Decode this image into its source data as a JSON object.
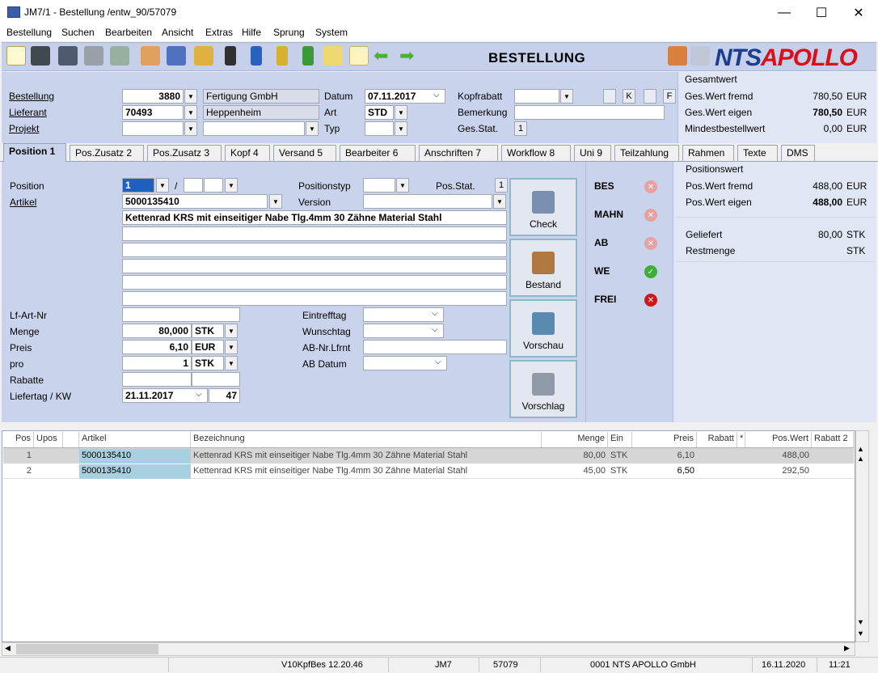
{
  "window": {
    "title": "JM7/1 - Bestellung /entw_90/57079",
    "minimize": "—",
    "maximize": "☐",
    "close": "✕"
  },
  "menu": [
    "Bestellung",
    "Suchen",
    "Bearbeiten",
    "Ansicht",
    "Extras",
    "Hilfe",
    "Sprung",
    "System"
  ],
  "toolbar": {
    "title": "BESTELLUNG",
    "logo_nts": "NTS",
    "logo_apollo": "APOLLO",
    "icons": [
      "new-document-icon",
      "binoculars-icon",
      "save-icon",
      "print-icon",
      "recycle-icon",
      "users-icon",
      "user-info-icon",
      "lock-folder-icon",
      "binder-black-icon",
      "binder-blue-icon",
      "binder-yellow-icon",
      "binder-green-icon",
      "notes-icon",
      "document-new-icon",
      "arrow-left-icon",
      "arrow-right-icon"
    ]
  },
  "header": {
    "bestellung_label": "Bestellung",
    "bestellung_value": "3880",
    "bestellung_name": "Fertigung GmbH",
    "lieferant_label": "Lieferant",
    "lieferant_value": "70493",
    "lieferant_name": "Heppenheim",
    "projekt_label": "Projekt",
    "projekt_value": "",
    "projekt_name": "",
    "datum_label": "Datum",
    "datum_value": "07.11.2017",
    "art_label": "Art",
    "art_value": "STD",
    "typ_label": "Typ",
    "typ_value": "",
    "kopfrabatt_label": "Kopfrabatt",
    "kopfrabatt_value": "",
    "bemerkung_label": "Bemerkung",
    "bemerkung_value": "",
    "gesstat_label": "Ges.Stat.",
    "gesstat_value": "1",
    "flag_k": "K",
    "flag_f": "F"
  },
  "summary": {
    "title": "Gesamtwert",
    "rows": [
      {
        "label": "Ges.Wert fremd",
        "value": "780,50",
        "unit": "EUR",
        "bold": false
      },
      {
        "label": "Ges.Wert eigen",
        "value": "780,50",
        "unit": "EUR",
        "bold": true
      },
      {
        "label": "Mindestbestellwert",
        "value": "0,00",
        "unit": "EUR",
        "bold": false
      }
    ]
  },
  "tabs": [
    {
      "label": "Position 1",
      "active": true
    },
    {
      "label": "Pos.Zusatz 2",
      "active": false
    },
    {
      "label": "Pos.Zusatz 3",
      "active": false
    },
    {
      "label": "Kopf 4",
      "active": false
    },
    {
      "label": "Versand 5",
      "active": false
    },
    {
      "label": "Bearbeiter 6",
      "active": false
    },
    {
      "label": "Anschriften 7",
      "active": false
    },
    {
      "label": "Workflow 8",
      "active": false
    },
    {
      "label": "Uni 9",
      "active": false
    },
    {
      "label": "Teilzahlung",
      "active": false
    },
    {
      "label": "Rahmen",
      "active": false
    },
    {
      "label": "Texte",
      "active": false
    },
    {
      "label": "DMS",
      "active": false
    }
  ],
  "position": {
    "position_label": "Position",
    "position_value": "1",
    "slash": "/",
    "artikel_label": "Artikel",
    "artikel_value": "5000135410",
    "positionstyp_label": "Positionstyp",
    "posstat_label": "Pos.Stat.",
    "posstat_value": "1",
    "version_label": "Version",
    "description_line1": "Kettenrad KRS mit einseitiger Nabe Tlg.4mm   30 Zähne   Material Stahl",
    "lfartnr_label": "Lf-Art-Nr",
    "menge_label": "Menge",
    "menge_value": "80,000",
    "menge_unit": "STK",
    "preis_label": "Preis",
    "preis_value": "6,10",
    "preis_unit": "EUR",
    "pro_label": "pro",
    "pro_value": "1",
    "pro_unit": "STK",
    "rabatte_label": "Rabatte",
    "liefertag_label": "Liefertag / KW",
    "liefertag_value": "21.11.2017",
    "kw_value": "47",
    "eintrefftag_label": "Eintrefftag",
    "wunschtag_label": "Wunschtag",
    "abnr_label": "AB-Nr.Lfrnt",
    "abdatum_label": "AB Datum"
  },
  "side_buttons": [
    {
      "label": "Check",
      "icon": "calculator-icon"
    },
    {
      "label": "Bestand",
      "icon": "shelf-icon"
    },
    {
      "label": "Vorschau",
      "icon": "chart-preview-icon"
    },
    {
      "label": "Vorschlag",
      "icon": "shopping-cart-icon"
    }
  ],
  "statuses": [
    {
      "label": "BES",
      "state": "inactive"
    },
    {
      "label": "MAHN",
      "state": "inactive"
    },
    {
      "label": "AB",
      "state": "inactive"
    },
    {
      "label": "WE",
      "state": "ok"
    },
    {
      "label": "FREI",
      "state": "error"
    }
  ],
  "positionswert": {
    "title": "Positionswert",
    "fremd_label": "Pos.Wert fremd",
    "fremd_value": "488,00",
    "fremd_unit": "EUR",
    "eigen_label": "Pos.Wert eigen",
    "eigen_value": "488,00",
    "eigen_unit": "EUR",
    "geliefert_label": "Geliefert",
    "geliefert_value": "80,00",
    "geliefert_unit": "STK",
    "rest_label": "Restmenge",
    "rest_unit": "STK"
  },
  "grid": {
    "headers": [
      "Pos",
      "Upos",
      "",
      "Artikel",
      "Bezeichnung",
      "Menge",
      "Ein",
      "Preis",
      "Rabatt",
      "*",
      "Pos.Wert",
      "Rabatt 2"
    ],
    "rows": [
      {
        "pos": "1",
        "upos": "",
        "artikel": "5000135410",
        "bezeichnung": "Kettenrad KRS mit einseitiger Nabe Tlg.4mm   30 Zähne   Material Stahl",
        "menge": "80,00",
        "ein": "STK",
        "preis": "6,10",
        "rabatt": "",
        "poswert": "488,00"
      },
      {
        "pos": "2",
        "upos": "",
        "artikel": "5000135410",
        "bezeichnung": "Kettenrad KRS mit einseitiger Nabe Tlg.4mm   30 Zähne   Material Stahl",
        "menge": "45,00",
        "ein": "STK",
        "preis": "6,50",
        "rabatt": "",
        "poswert": "292,50"
      }
    ]
  },
  "statusbar": {
    "program": "V10KpfBes 12.20.46",
    "module": "JM7",
    "session": "57079",
    "company": "0001 NTS APOLLO GmbH",
    "date": "16.11.2020",
    "time": "11:21"
  }
}
